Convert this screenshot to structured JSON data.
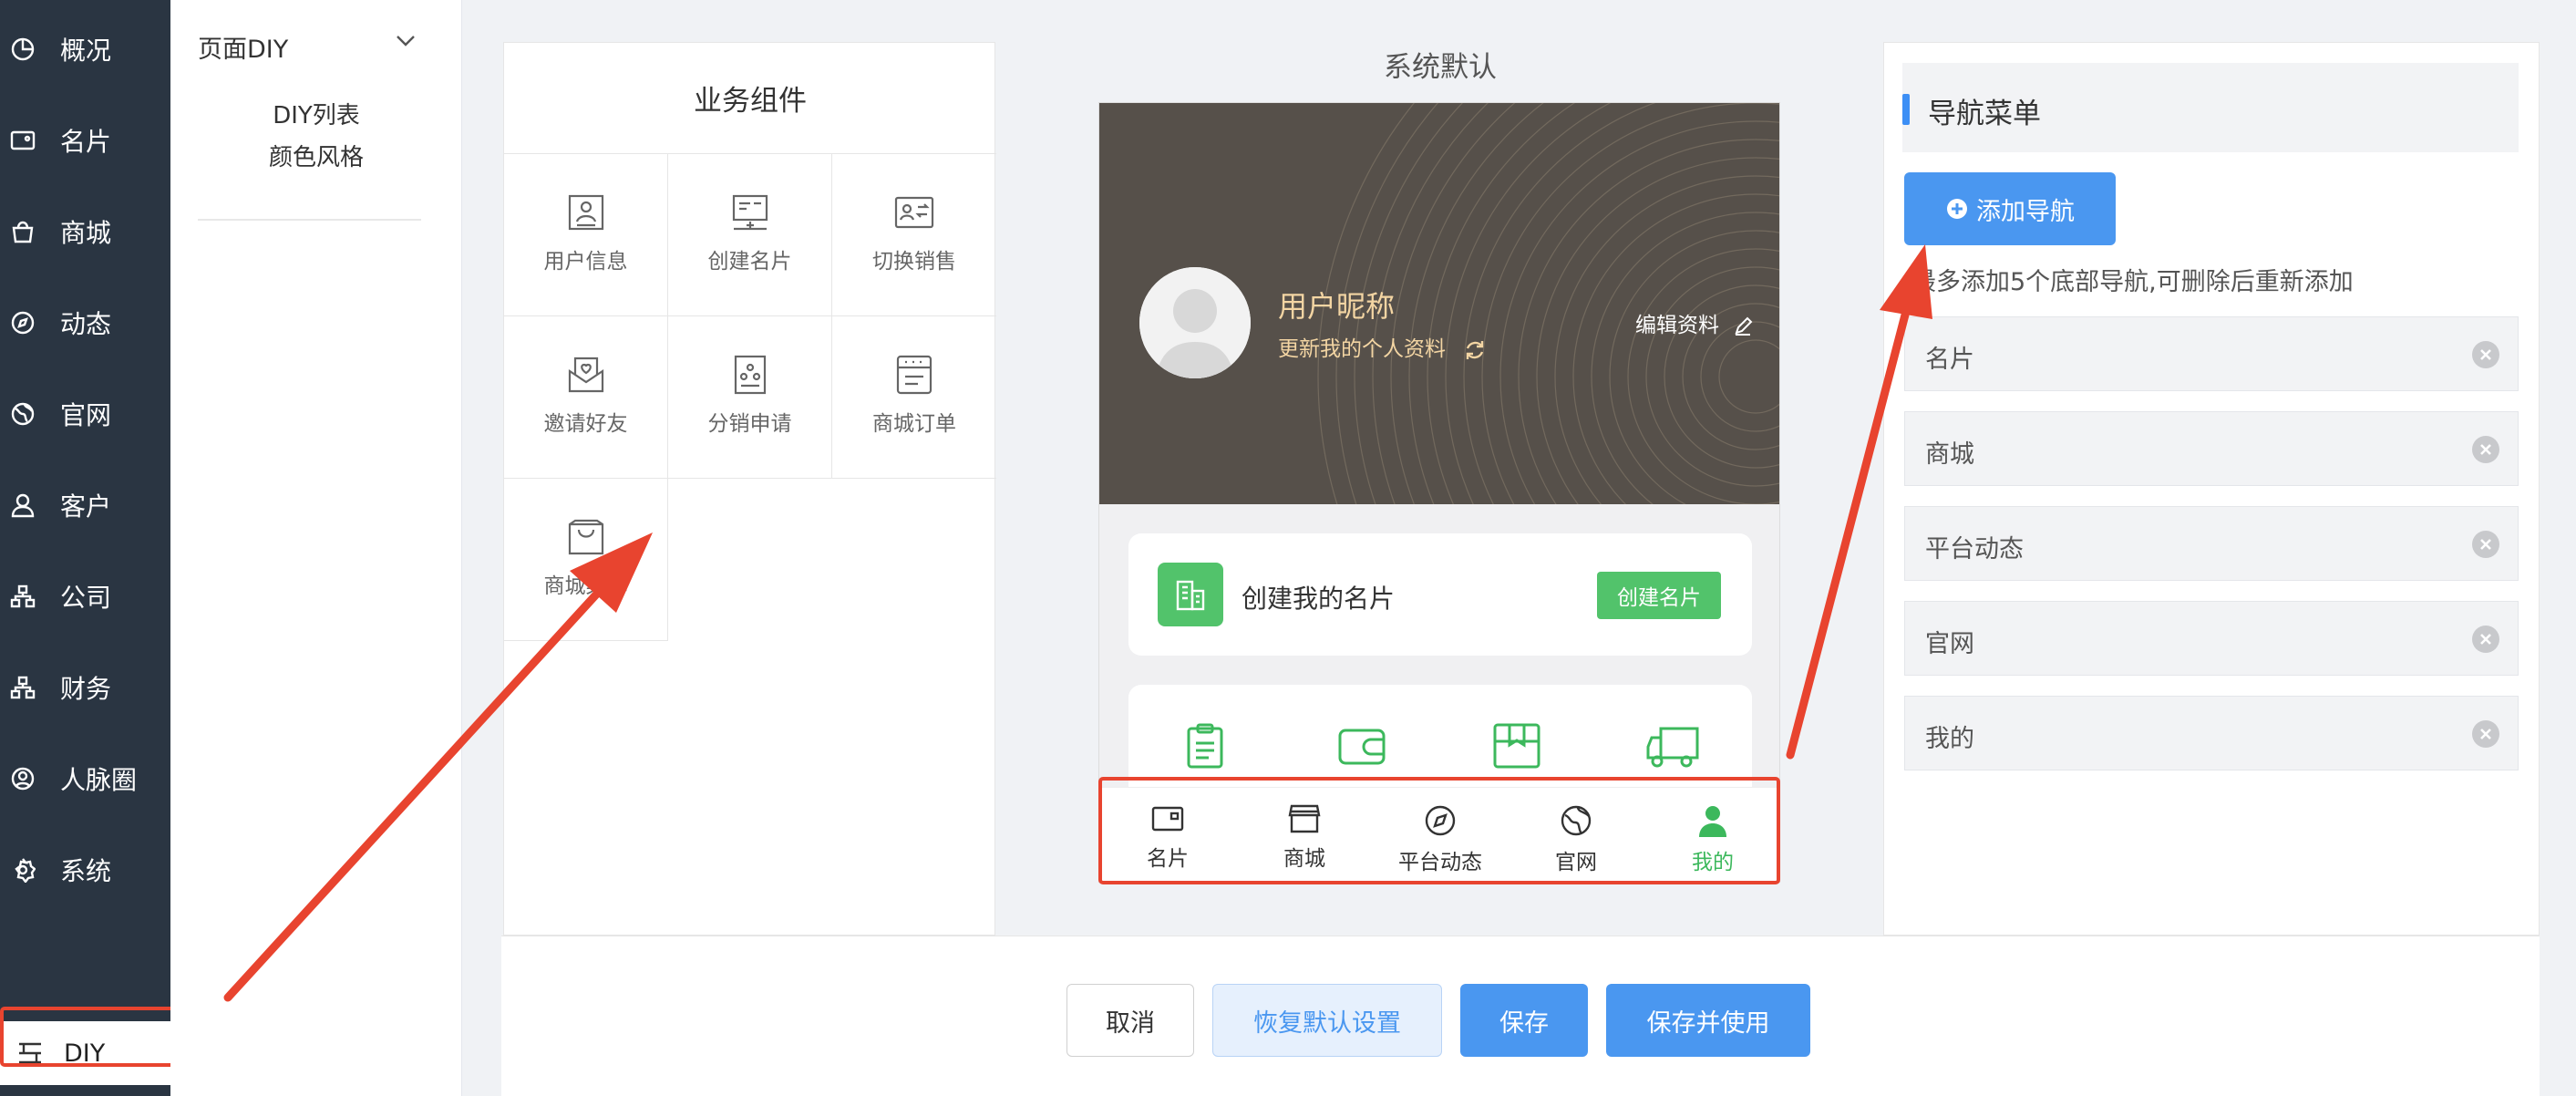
{
  "sidebar": {
    "items": [
      {
        "label": "概况",
        "icon": "pie-chart-icon"
      },
      {
        "label": "名片",
        "icon": "wallet-icon"
      },
      {
        "label": "商城",
        "icon": "shopping-bag-icon"
      },
      {
        "label": "动态",
        "icon": "compass-icon"
      },
      {
        "label": "官网",
        "icon": "globe-icon"
      },
      {
        "label": "客户",
        "icon": "user-icon"
      },
      {
        "label": "公司",
        "icon": "org-chart-icon"
      },
      {
        "label": "财务",
        "icon": "org-chart-icon"
      },
      {
        "label": "人脉圈",
        "icon": "person-circle-icon"
      },
      {
        "label": "系统",
        "icon": "gear-icon"
      }
    ],
    "diy_label": "DIY"
  },
  "submenu": {
    "title": "页面DIY",
    "links": [
      "DIY列表",
      "颜色风格"
    ]
  },
  "components": {
    "title": "业务组件",
    "items": [
      {
        "label": "用户信息",
        "icon": "user-info-icon"
      },
      {
        "label": "创建名片",
        "icon": "create-card-icon"
      },
      {
        "label": "切换销售",
        "icon": "switch-sales-icon"
      },
      {
        "label": "邀请好友",
        "icon": "invite-friend-icon"
      },
      {
        "label": "分销申请",
        "icon": "distribution-apply-icon"
      },
      {
        "label": "商城订单",
        "icon": "mall-order-icon"
      },
      {
        "label": "商城菜单",
        "icon": "mall-bag-icon"
      }
    ]
  },
  "preview": {
    "title": "系统默认",
    "nickname": "用户昵称",
    "update_profile": "更新我的个人资料",
    "edit_profile": "编辑资料",
    "create_card_text": "创建我的名片",
    "create_card_button": "创建名片",
    "tabbar": [
      {
        "label": "名片",
        "icon": "wallet-icon"
      },
      {
        "label": "商城",
        "icon": "store-icon"
      },
      {
        "label": "平台动态",
        "icon": "compass-icon"
      },
      {
        "label": "官网",
        "icon": "globe-icon"
      },
      {
        "label": "我的",
        "icon": "user-icon"
      }
    ],
    "active_tab_color": "#3cb85c"
  },
  "nav_menu": {
    "title": "导航菜单",
    "add_button": "添加导航",
    "tip": "最多添加5个底部导航,可删除后重新添加",
    "items": [
      "名片",
      "商城",
      "平台动态",
      "官网",
      "我的"
    ]
  },
  "footer": {
    "cancel": "取消",
    "restore": "恢复默认设置",
    "save": "保存",
    "save_use": "保存并使用"
  },
  "colors": {
    "sidebar_bg": "#2a3542",
    "primary": "#4a97f0",
    "green": "#52c36b",
    "annotation_red": "#e8442f"
  }
}
